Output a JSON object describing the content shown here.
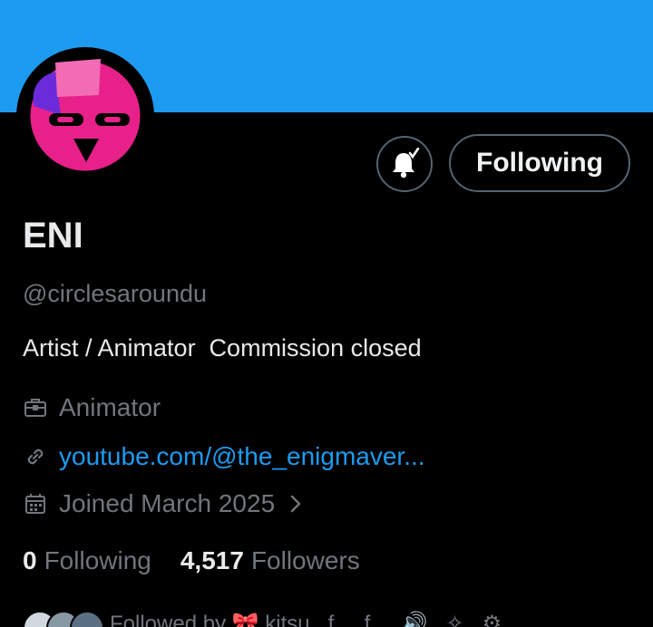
{
  "theme": {
    "banner_color": "#1d9bf0",
    "background": "#000000",
    "accent": "#1d9bf0",
    "muted": "#71767b"
  },
  "profile": {
    "display_name": "ENI",
    "handle": "@circlesaroundu",
    "bio": "Artist / Animator  Commission closed",
    "job": "Animator",
    "website": "youtube.com/@the_enigmaver...",
    "joined": "Joined March 2025"
  },
  "actions": {
    "notify_icon": "bell-check-icon",
    "follow_label": "Following"
  },
  "stats": {
    "following_count": "0",
    "following_label": "Following",
    "followers_count": "4,517",
    "followers_label": "Followers"
  },
  "followed_by": {
    "text": "Followed by 🎀 kitsu , f.. , f.. , 🔊 , ✧ , ⚙ ..."
  }
}
